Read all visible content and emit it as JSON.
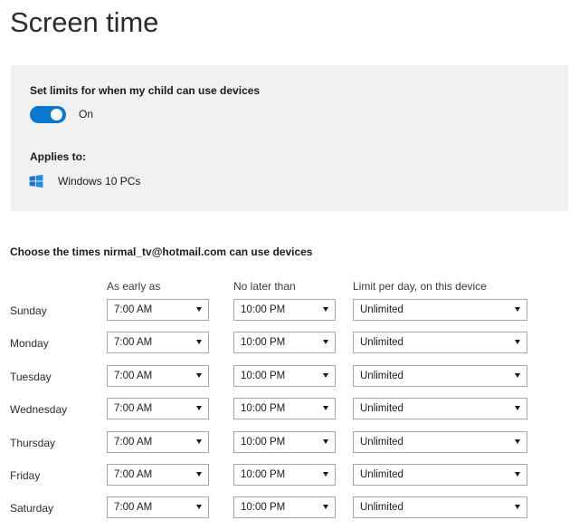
{
  "page": {
    "title": "Screen time"
  },
  "panel": {
    "heading": "Set limits for when my child can use devices",
    "toggle_state_label": "On",
    "toggle_on": true,
    "applies_to_label": "Applies to:",
    "device_label": "Windows 10 PCs",
    "device_icon": "windows-logo-icon",
    "accent_color": "#0b78d0",
    "background_color": "#f0f0f0"
  },
  "schedule": {
    "intro": "Choose the times nirmal_tv@hotmail.com can use devices",
    "columns": [
      {
        "label": "As early as"
      },
      {
        "label": "No later than"
      },
      {
        "label": "Limit per day, on this device"
      }
    ],
    "rows": [
      {
        "day": "Sunday",
        "as_early_as": "7:00 AM",
        "no_later_than": "10:00 PM",
        "limit_per_day": "Unlimited"
      },
      {
        "day": "Monday",
        "as_early_as": "7:00 AM",
        "no_later_than": "10:00 PM",
        "limit_per_day": "Unlimited"
      },
      {
        "day": "Tuesday",
        "as_early_as": "7:00 AM",
        "no_later_than": "10:00 PM",
        "limit_per_day": "Unlimited"
      },
      {
        "day": "Wednesday",
        "as_early_as": "7:00 AM",
        "no_later_than": "10:00 PM",
        "limit_per_day": "Unlimited"
      },
      {
        "day": "Thursday",
        "as_early_as": "7:00 AM",
        "no_later_than": "10:00 PM",
        "limit_per_day": "Unlimited"
      },
      {
        "day": "Friday",
        "as_early_as": "7:00 AM",
        "no_later_than": "10:00 PM",
        "limit_per_day": "Unlimited"
      },
      {
        "day": "Saturday",
        "as_early_as": "7:00 AM",
        "no_later_than": "10:00 PM",
        "limit_per_day": "Unlimited"
      }
    ]
  }
}
